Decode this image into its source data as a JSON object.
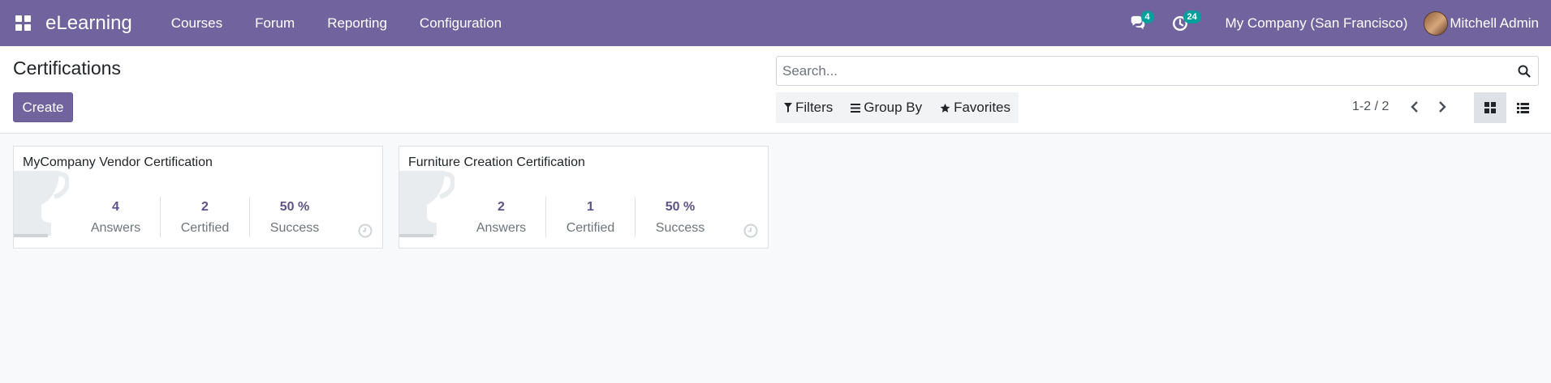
{
  "navbar": {
    "app_name": "eLearning",
    "menu": [
      "Courses",
      "Forum",
      "Reporting",
      "Configuration"
    ],
    "messages_count": "4",
    "activities_count": "24",
    "company": "My Company (San Francisco)",
    "user": "Mitchell Admin"
  },
  "control_panel": {
    "breadcrumb": "Certifications",
    "create_label": "Create",
    "search_placeholder": "Search...",
    "filters_label": "Filters",
    "groupby_label": "Group By",
    "favorites_label": "Favorites",
    "pager": "1-2 / 2"
  },
  "cards": [
    {
      "title": "MyCompany Vendor Certification",
      "stats": [
        {
          "value": "4",
          "label": "Answers"
        },
        {
          "value": "2",
          "label": "Certified"
        },
        {
          "value": "50 %",
          "label": "Success"
        }
      ]
    },
    {
      "title": "Furniture Creation Certification",
      "stats": [
        {
          "value": "2",
          "label": "Answers"
        },
        {
          "value": "1",
          "label": "Certified"
        },
        {
          "value": "50 %",
          "label": "Success"
        }
      ]
    }
  ],
  "colors": {
    "brand": "#71639e",
    "badge": "#00a09d",
    "stat_value": "#5f5289"
  }
}
